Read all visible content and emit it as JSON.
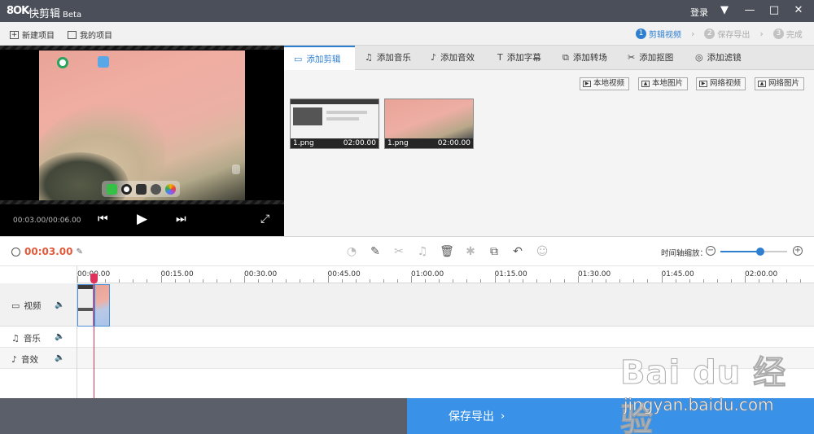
{
  "titlebar": {
    "logo": "8OK",
    "app_name": "快剪辑",
    "beta": "Beta",
    "login": "登录"
  },
  "toolbar": {
    "new_project": "新建项目",
    "my_projects": "我的项目",
    "steps": [
      {
        "num": "1",
        "label": "剪辑视频",
        "active": true
      },
      {
        "num": "2",
        "label": "保存导出",
        "active": false
      },
      {
        "num": "3",
        "label": "完成",
        "active": false
      }
    ]
  },
  "preview": {
    "time": "00:03.00/00:06.00"
  },
  "tabs": [
    {
      "label": "添加剪辑",
      "icon": "video-camera-icon",
      "active": true
    },
    {
      "label": "添加音乐",
      "icon": "music-note-icon",
      "active": false
    },
    {
      "label": "添加音效",
      "icon": "sound-effect-icon",
      "active": false
    },
    {
      "label": "添加字幕",
      "icon": "text-icon",
      "active": false
    },
    {
      "label": "添加转场",
      "icon": "transition-icon",
      "active": false
    },
    {
      "label": "添加抠图",
      "icon": "cutout-icon",
      "active": false
    },
    {
      "label": "添加滤镜",
      "icon": "filter-icon",
      "active": false
    }
  ],
  "sources": [
    "本地视频",
    "本地图片",
    "网络视频",
    "网络图片"
  ],
  "media": [
    {
      "name": "1.png",
      "duration": "02:00.00"
    },
    {
      "name": "1.png",
      "duration": "02:00.00"
    }
  ],
  "timeline": {
    "current_time": "00:03.00",
    "zoom_label": "时间轴缩放：",
    "zoom_level": 0.6,
    "ruler": [
      "00:00.00",
      "00:15.00",
      "00:30.00",
      "00:45.00",
      "01:00.00",
      "01:15.00",
      "01:30.00",
      "01:45.00",
      "02:00.00"
    ],
    "tracks": [
      {
        "label": "视频",
        "icon": "video-camera-icon"
      },
      {
        "label": "音乐",
        "icon": "music-note-icon"
      },
      {
        "label": "音效",
        "icon": "sound-effect-icon"
      }
    ]
  },
  "bottom": {
    "save_export": "保存导出"
  },
  "watermark": {
    "logo": "Bai du 经验",
    "url": "jingyan.baidu.com"
  },
  "colors": {
    "accent": "#2f7fd1",
    "export": "#3a92e8",
    "titlebar": "#4a4f59",
    "current_time": "#e05a3a",
    "playhead": "#e0325a"
  }
}
